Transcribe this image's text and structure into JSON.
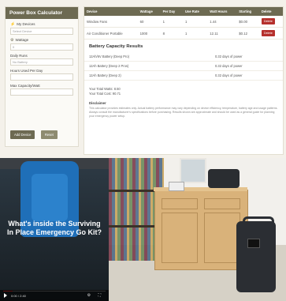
{
  "calculator": {
    "title": "Power Box Calculator",
    "fields": [
      {
        "label": "My Devices",
        "icon": "plug-icon",
        "value": "Select Device"
      },
      {
        "label": "Wattage",
        "icon": "bolt-icon",
        "value": "0"
      },
      {
        "label": "Daily Runs",
        "icon": "",
        "value": "No Battery"
      },
      {
        "label": "Hours Used Per Day",
        "icon": "",
        "value": ""
      },
      {
        "label": "Max Capacity/Watt",
        "icon": "",
        "value": ""
      }
    ],
    "calculate_label": "Add Device",
    "reset_label": "Reset"
  },
  "table": {
    "headers": [
      "Device",
      "Wattage",
      "Per Day",
      "Use Rate",
      "Watt Hours",
      "Starting",
      "Delete"
    ],
    "rows": [
      {
        "cells": [
          "Window Fans",
          "60",
          "1",
          "1",
          "1.44",
          "$0.00"
        ],
        "delete": "Delete"
      },
      {
        "cells": [
          "Air Conditioner Portable",
          "1000",
          "8",
          "1",
          "12.11",
          "$0.12"
        ],
        "delete": "Delete"
      }
    ]
  },
  "results": {
    "title": "Battery Capacity Results",
    "rows": [
      {
        "label": "12Ah/6V Battery (Deep Pro)",
        "value": "0.32 days of power"
      },
      {
        "label": "12Ah Battery (Deep 2 Pros)",
        "value": "0.32 days of power"
      },
      {
        "label": "12Ah Battery (Deep 2)",
        "value": "0.32 days of power"
      }
    ],
    "total_watts": "Your Total Watts: 8.50",
    "total_cost": "Your Total Cost: 90.71",
    "disclaimer_title": "Disclaimer",
    "disclaimer": "This calculator provides estimates only. Actual battery performance may vary depending on device efficiency, temperature, battery age and usage patterns. Always consult the manufacturer's specifications before purchasing. Results shown are approximate and should be used as a general guide for planning your emergency power setup."
  },
  "video": {
    "title": "What's inside the Surviving In Place Emergency Go Kit?",
    "time": "0:00 / 2:40",
    "progress": 0.09
  }
}
